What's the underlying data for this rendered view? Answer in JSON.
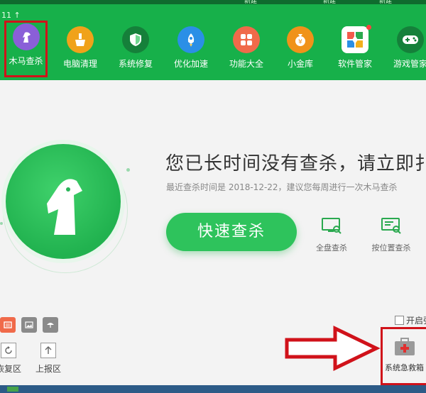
{
  "window": {
    "top_labels": [
      "新建",
      "新建",
      "新建"
    ],
    "version": "11 ↑"
  },
  "nav": {
    "items": [
      {
        "label": "木马查杀",
        "icon": "horse-icon",
        "color": "#8a5fd8",
        "active": true
      },
      {
        "label": "电脑清理",
        "icon": "broom-icon",
        "color": "#f0a21a"
      },
      {
        "label": "系统修复",
        "icon": "shield-icon",
        "color": "#1e9e3e"
      },
      {
        "label": "优化加速",
        "icon": "rocket-icon",
        "color": "#2b8fe6"
      },
      {
        "label": "功能大全",
        "icon": "grid-icon",
        "color": "#f06a4a"
      },
      {
        "label": "小金库",
        "icon": "money-bag-icon",
        "color": "#f0921a"
      },
      {
        "label": "软件管家",
        "icon": "apps-icon",
        "color": "#ffffff"
      },
      {
        "label": "游戏管家",
        "icon": "gamepad-icon",
        "color": "#1e9e3e"
      }
    ]
  },
  "main": {
    "headline": "您已长时间没有查杀，请立即扌",
    "subline": "最近查杀时间是 2018-12-22，建议您每周进行一次木马查杀",
    "fast_scan": "快速查杀",
    "full_scan": "全盘查杀",
    "custom_scan": "按位置查杀",
    "checkbox_label": "开启弘",
    "tools": {
      "restore": "恢复区",
      "report": "上报区",
      "rescue": "系统急救箱"
    }
  },
  "colors": {
    "header": "#17b04a",
    "accent": "#2ec35c",
    "highlight": "#d0121a"
  }
}
